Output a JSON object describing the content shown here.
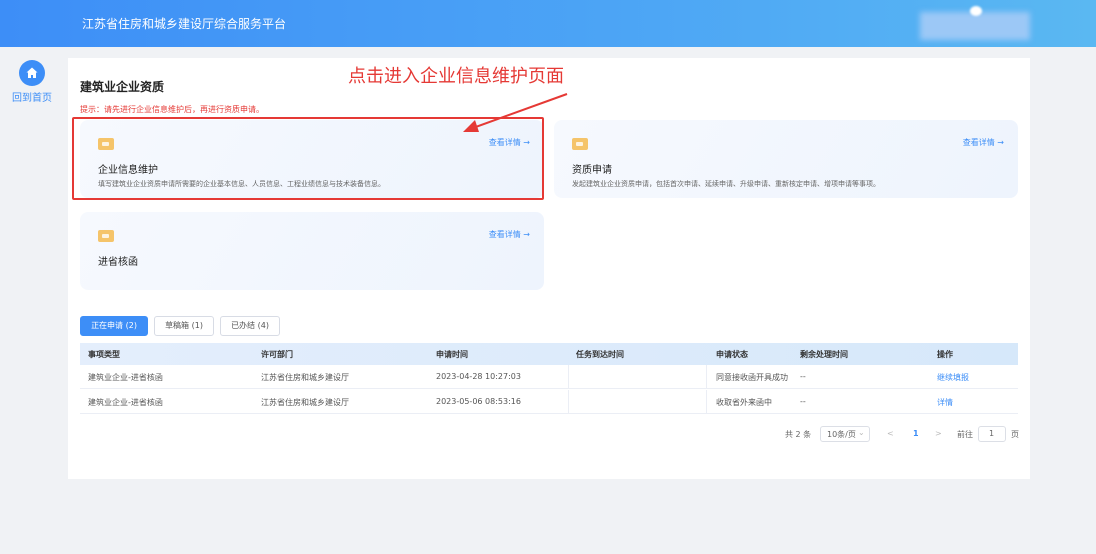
{
  "header": {
    "title": "江苏省住房和城乡建设厅综合服务平台"
  },
  "sidebar": {
    "home_label": "回到首页"
  },
  "panel": {
    "title": "建筑业企业资质",
    "tip": "提示：请先进行企业信息维护后，再进行资质申请。"
  },
  "annotation": {
    "text": "点击进入企业信息维护页面"
  },
  "cards": [
    {
      "name": "企业信息维护",
      "link": "查看详情 →",
      "desc": "填写建筑业企业资质申请所需要的企业基本信息、人员信息、工程业绩信息与技术装备信息。"
    },
    {
      "name": "资质申请",
      "link": "查看详情 →",
      "desc": "发起建筑业企业资质申请，包括首次申请、延续申请、升级申请、重新核定申请、增项申请等事项。"
    },
    {
      "name": "进省核函",
      "link": "查看详情 →",
      "desc": ""
    }
  ],
  "tabs": [
    {
      "label": "正在申请 (2)",
      "active": true
    },
    {
      "label": "草稿箱 (1)",
      "active": false
    },
    {
      "label": "已办结 (4)",
      "active": false
    }
  ],
  "table": {
    "headers": [
      "事项类型",
      "许可部门",
      "申请时间",
      "任务到达时间",
      "申请状态",
      "剩余处理时间",
      "操作"
    ],
    "rows": [
      [
        "建筑业企业-进省核函",
        "江苏省住房和城乡建设厅",
        "2023-04-28 10:27:03",
        "",
        "同意接收函开具成功",
        "--",
        "继续填报"
      ],
      [
        "建筑业企业-进省核函",
        "江苏省住房和城乡建设厅",
        "2023-05-06 08:53:16",
        "",
        "收取省外来函中",
        "--",
        "详情"
      ]
    ]
  },
  "pagination": {
    "total": "共 2 条",
    "page_size": "10条/页",
    "prev": "<",
    "current": "1",
    "next": ">",
    "goto_label": "前往",
    "goto_value": "1",
    "page_suffix": "页"
  },
  "colors": {
    "primary": "#3d8ef7",
    "danger": "#e53935",
    "folder": "#f5c46a"
  }
}
